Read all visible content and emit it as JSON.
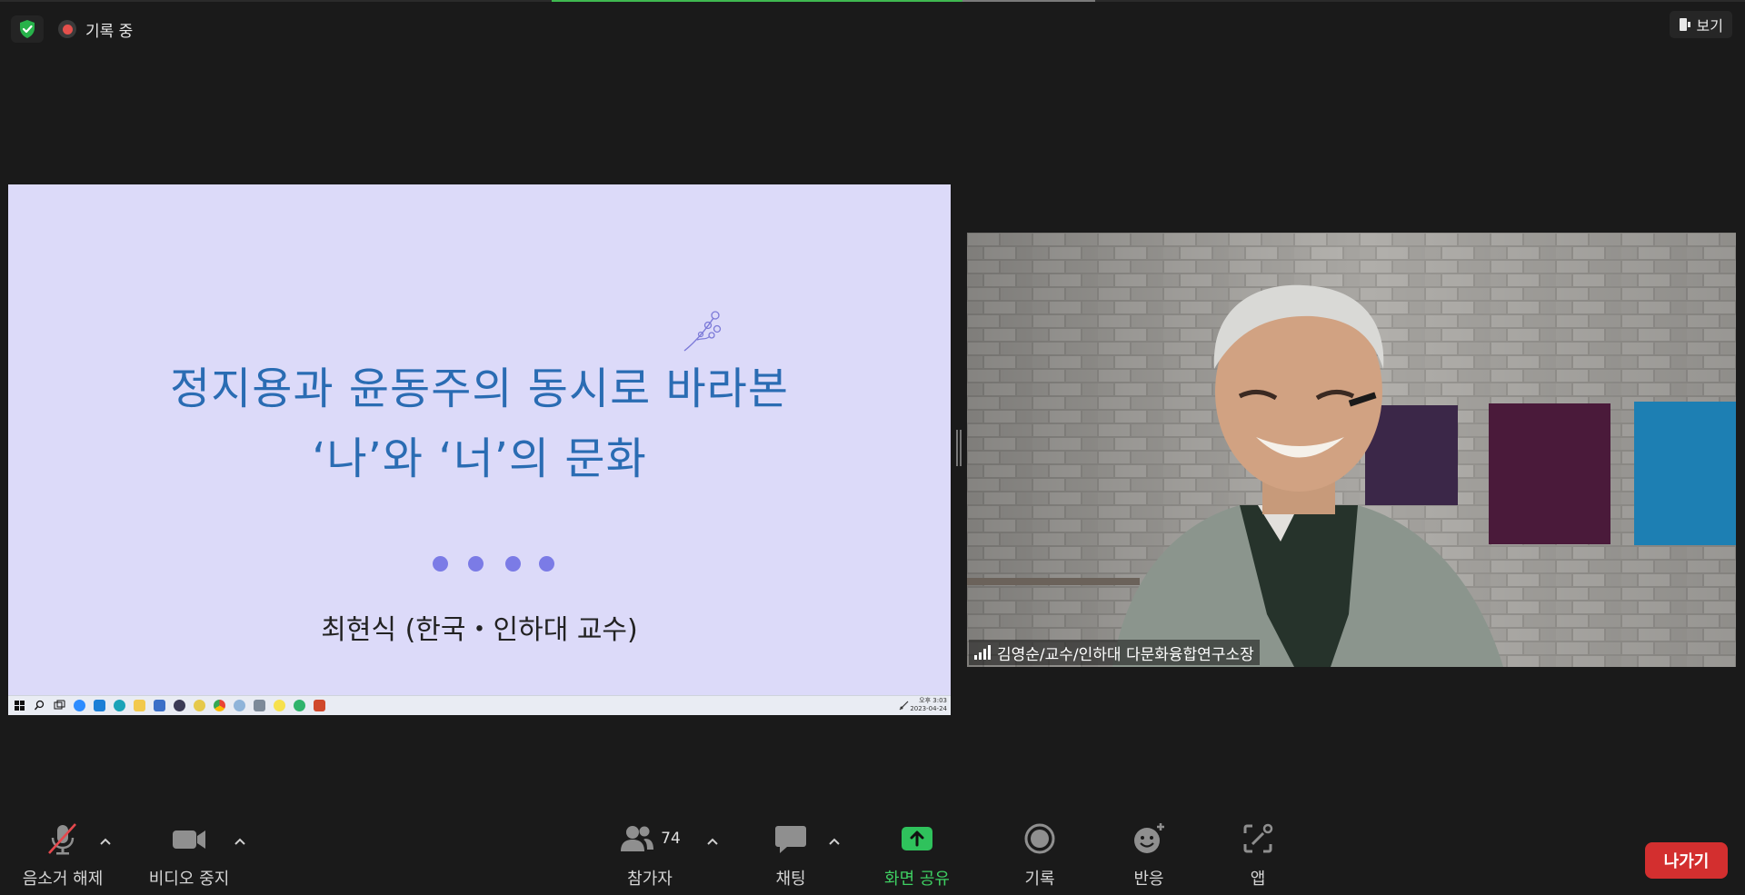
{
  "top_bar": {
    "recording_label": "기록 중",
    "view_label": "보기"
  },
  "slide": {
    "title_line1": "정지용과 윤동주의 동시로 바라본",
    "title_line2": "‘나’와 ‘너’의 문화",
    "presenter": "최현식 (한국・인하대 교수)",
    "taskbar_time": "오후 3:03",
    "taskbar_date": "2023-04-24"
  },
  "video": {
    "participant_name": "김영순/교수/인하대 다문화융합연구소장"
  },
  "toolbar": {
    "unmute_label": "음소거 해제",
    "stop_video_label": "비디오 중지",
    "participants_label": "참가자",
    "participants_count": "74",
    "chat_label": "채팅",
    "share_screen_label": "화면 공유",
    "record_label": "기록",
    "reactions_label": "반응",
    "apps_label": "앱",
    "leave_label": "나가기"
  },
  "colors": {
    "background": "#1a1a1a",
    "slide_bg": "#dcdaf9",
    "slide_title": "#2a6cb3",
    "share_green": "#3ecf62",
    "leave_red": "#d32f2f"
  }
}
